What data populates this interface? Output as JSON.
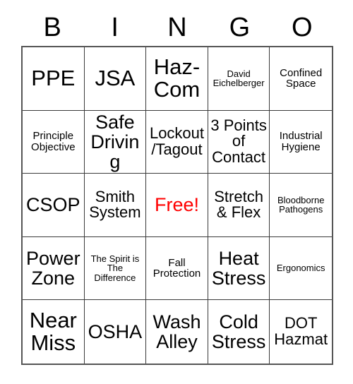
{
  "header": {
    "letters": [
      "B",
      "I",
      "N",
      "G",
      "O"
    ]
  },
  "accent_colors": {
    "free_space_text": "#ff0000",
    "grid_line": "#3a3a3a",
    "grid_outer_border": "#555555",
    "text": "#000000",
    "background": "#ffffff"
  },
  "grid": {
    "columns": 5,
    "rows": 5,
    "cells": [
      {
        "text": "PPE",
        "size": "xl",
        "free": false
      },
      {
        "text": "JSA",
        "size": "xl",
        "free": false
      },
      {
        "text": "Haz-Com",
        "size": "xl",
        "free": false
      },
      {
        "text": "David Eichelberger",
        "size": "xs",
        "free": false
      },
      {
        "text": "Confined Space",
        "size": "sm",
        "free": false
      },
      {
        "text": "Principle Objective",
        "size": "sm",
        "free": false
      },
      {
        "text": "Safe Driving",
        "size": "lg",
        "free": false
      },
      {
        "text": "Lockout/Tagout",
        "size": "md",
        "free": false
      },
      {
        "text": "3 Points of Contact",
        "size": "md",
        "free": false
      },
      {
        "text": "Industrial Hygiene",
        "size": "sm",
        "free": false
      },
      {
        "text": "CSOP",
        "size": "lg",
        "free": false
      },
      {
        "text": "Smith System",
        "size": "md",
        "free": false
      },
      {
        "text": "Free!",
        "size": "lg",
        "free": true
      },
      {
        "text": "Stretch & Flex",
        "size": "md",
        "free": false
      },
      {
        "text": "Bloodborne Pathogens",
        "size": "xs",
        "free": false
      },
      {
        "text": "Power Zone",
        "size": "lg",
        "free": false
      },
      {
        "text": "The Spirit is The Difference",
        "size": "xs",
        "free": false
      },
      {
        "text": "Fall Protection",
        "size": "sm",
        "free": false
      },
      {
        "text": "Heat Stress",
        "size": "lg",
        "free": false
      },
      {
        "text": "Ergonomics",
        "size": "xs",
        "free": false
      },
      {
        "text": "Near Miss",
        "size": "xl",
        "free": false
      },
      {
        "text": "OSHA",
        "size": "lg",
        "free": false
      },
      {
        "text": "Wash Alley",
        "size": "lg",
        "free": false
      },
      {
        "text": "Cold Stress",
        "size": "lg",
        "free": false
      },
      {
        "text": "DOT Hazmat",
        "size": "md",
        "free": false
      }
    ]
  }
}
